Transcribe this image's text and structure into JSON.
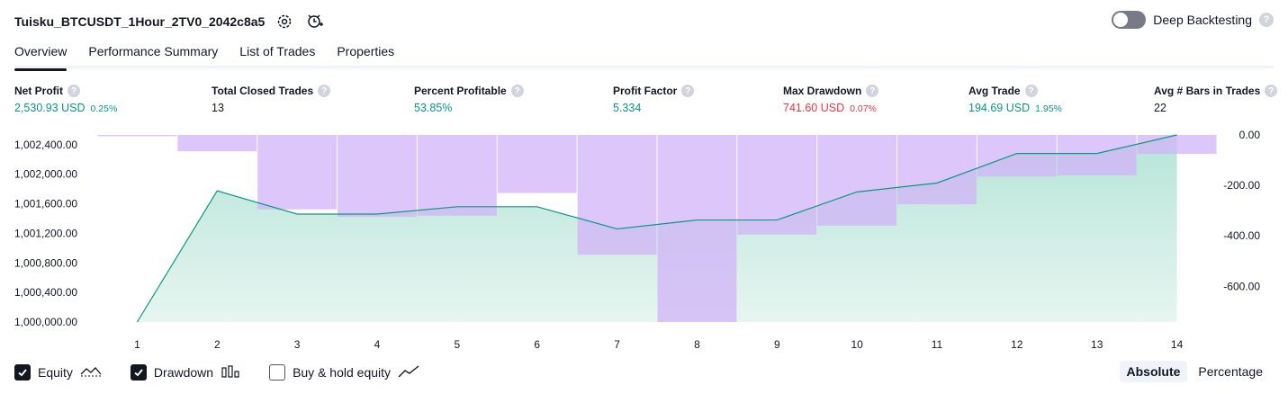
{
  "strategy": {
    "name": "Tuisku_BTCUSDT_1Hour_2TV0_2042c8a5",
    "icons": [
      "settings-icon",
      "add-alert-icon"
    ]
  },
  "deep_backtesting": {
    "label": "Deep Backtesting",
    "enabled": false
  },
  "tabs": [
    {
      "label": "Overview",
      "active": true
    },
    {
      "label": "Performance Summary",
      "active": false
    },
    {
      "label": "List of Trades",
      "active": false
    },
    {
      "label": "Properties",
      "active": false
    }
  ],
  "metrics": [
    {
      "label": "Net Profit",
      "value": "2,530.93 USD",
      "pct": "0.25%",
      "tone": "pos"
    },
    {
      "label": "Total Closed Trades",
      "value": "13",
      "pct": "",
      "tone": "neutral"
    },
    {
      "label": "Percent Profitable",
      "value": "53.85%",
      "pct": "",
      "tone": "pos"
    },
    {
      "label": "Profit Factor",
      "value": "5.334",
      "pct": "",
      "tone": "pos"
    },
    {
      "label": "Max Drawdown",
      "value": "741.60 USD",
      "pct": "0.07%",
      "tone": "neg"
    },
    {
      "label": "Avg Trade",
      "value": "194.69 USD",
      "pct": "1.95%",
      "tone": "pos"
    },
    {
      "label": "Avg # Bars in Trades",
      "value": "22",
      "pct": "",
      "tone": "neutral"
    }
  ],
  "chart_data": {
    "type": "area",
    "x": [
      1,
      2,
      3,
      4,
      5,
      6,
      7,
      8,
      9,
      10,
      11,
      12,
      13,
      14
    ],
    "left_axis_ticks": [
      "1,002,400.00",
      "1,002,000.00",
      "1,001,600.00",
      "1,001,200.00",
      "1,000,800.00",
      "1,000,400.00",
      "1,000,000.00"
    ],
    "left_ylim": [
      1000000,
      1002530.93
    ],
    "right_axis_ticks": [
      "0.00",
      "-200.00",
      "-400.00",
      "-600.00"
    ],
    "right_ylim": [
      -741.6,
      0
    ],
    "series": [
      {
        "role": "equity",
        "type": "line",
        "color": "#089981",
        "values": [
          1000000,
          1001775,
          1001460,
          1001460,
          1001560,
          1001560,
          1001260,
          1001380,
          1001380,
          1001760,
          1001880,
          1002280,
          1002280,
          1002530.93
        ]
      },
      {
        "role": "drawdown",
        "type": "bar",
        "color": "#d1b3f8",
        "values": [
          -5,
          -65,
          -295,
          -325,
          -320,
          -230,
          -475,
          -741.6,
          -395,
          -360,
          -275,
          -165,
          -160,
          -75
        ]
      }
    ]
  },
  "legend": [
    {
      "label": "Equity",
      "checked": true,
      "icon": "equity-line-icon"
    },
    {
      "label": "Drawdown",
      "checked": true,
      "icon": "drawdown-bars-icon"
    },
    {
      "label": "Buy & hold equity",
      "checked": false,
      "icon": "buy-hold-line-icon"
    }
  ],
  "mode": {
    "options": [
      "Absolute",
      "Percentage"
    ],
    "selected": "Absolute"
  }
}
